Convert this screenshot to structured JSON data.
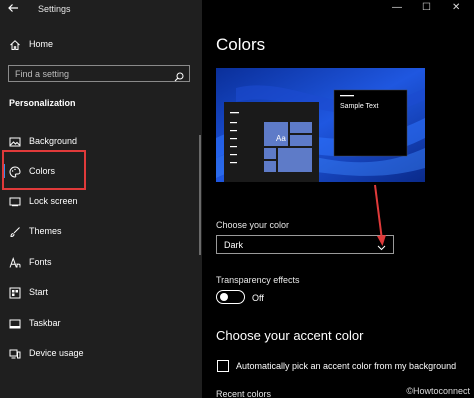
{
  "window": {
    "title": "Settings",
    "controls": {
      "minimize": "—",
      "maximize": "☐",
      "close": "✕"
    }
  },
  "sidebar": {
    "home_label": "Home",
    "search_placeholder": "Find a setting",
    "section_header": "Personalization",
    "items": [
      {
        "label": "Background",
        "icon": "image-icon"
      },
      {
        "label": "Colors",
        "icon": "palette-icon",
        "selected": true
      },
      {
        "label": "Lock screen",
        "icon": "lock-screen-icon"
      },
      {
        "label": "Themes",
        "icon": "brush-icon"
      },
      {
        "label": "Fonts",
        "icon": "font-icon"
      },
      {
        "label": "Start",
        "icon": "start-icon"
      },
      {
        "label": "Taskbar",
        "icon": "taskbar-icon"
      },
      {
        "label": "Device usage",
        "icon": "device-usage-icon"
      }
    ]
  },
  "main": {
    "title": "Colors",
    "preview": {
      "sample_text": "Sample Text",
      "tile_text": "Aa"
    },
    "choose_color": {
      "label": "Choose your color",
      "value": "Dark"
    },
    "transparency": {
      "label": "Transparency effects",
      "state": "Off",
      "on": false
    },
    "accent_heading": "Choose your accent color",
    "auto_accent": {
      "label": "Automatically pick an accent color from my background",
      "checked": false
    },
    "recent_colors_label": "Recent colors"
  },
  "watermark": "©Howtoconnect",
  "colors": {
    "sidebar_bg": "#1f1f1f",
    "main_bg": "#000000",
    "accent": "#3a8ee6",
    "highlight_box": "#e03a3a",
    "preview_blue": "#0b3aa8"
  }
}
